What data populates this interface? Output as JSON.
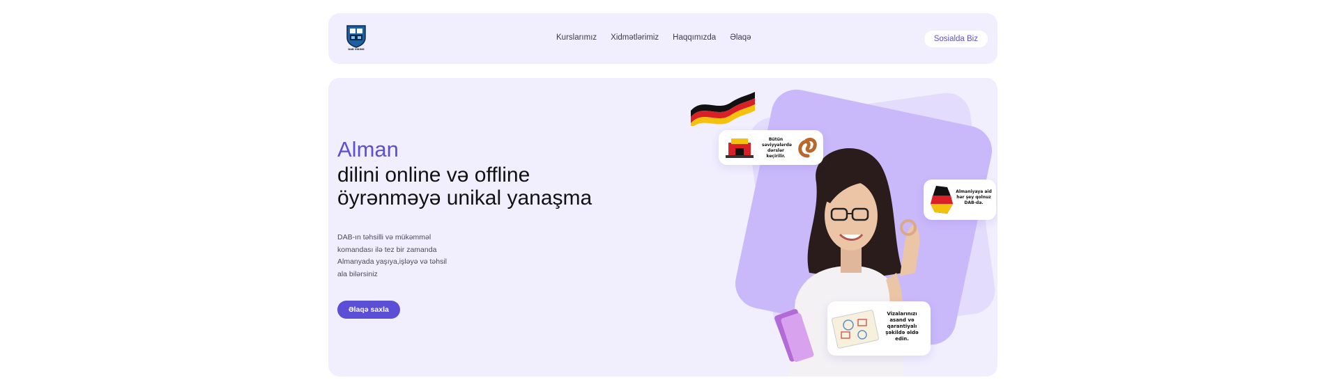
{
  "header": {
    "logo_caption": "DAB VIKING",
    "nav": [
      {
        "label": "Kurslarımız"
      },
      {
        "label": "Xidmətlərimiz"
      },
      {
        "label": "Haqqımızda"
      },
      {
        "label": "Əlaqə"
      }
    ],
    "social_label": "Sosialda Biz"
  },
  "hero": {
    "accent": "Alman",
    "title_line1": "dilini online və offline",
    "title_line2": "öyrənməyə unikal yanaşma",
    "desc_line1": "DAB-ın təhsilli və mükəmməl",
    "desc_line2": "komandası ilə tez bir zamanda",
    "desc_line3": "Almanyada yaşıya,işləyə və təhsil",
    "desc_line4": "ala bilərsiniz",
    "cta_label": "Əlaqə saxla"
  },
  "cards": {
    "card1_text": "Bütün səviyyələrdə dərslər keçirilir.",
    "card2_text": "Almaniyaya aid hər şey qolnuz DAB-da.",
    "card3_text": "Vizalarınızı asand və qarantiyalı şəkildə əldə edin."
  },
  "colors": {
    "accent": "#5b4fd6",
    "panel": "#f1eefe",
    "shape": "#c9b9fb"
  }
}
